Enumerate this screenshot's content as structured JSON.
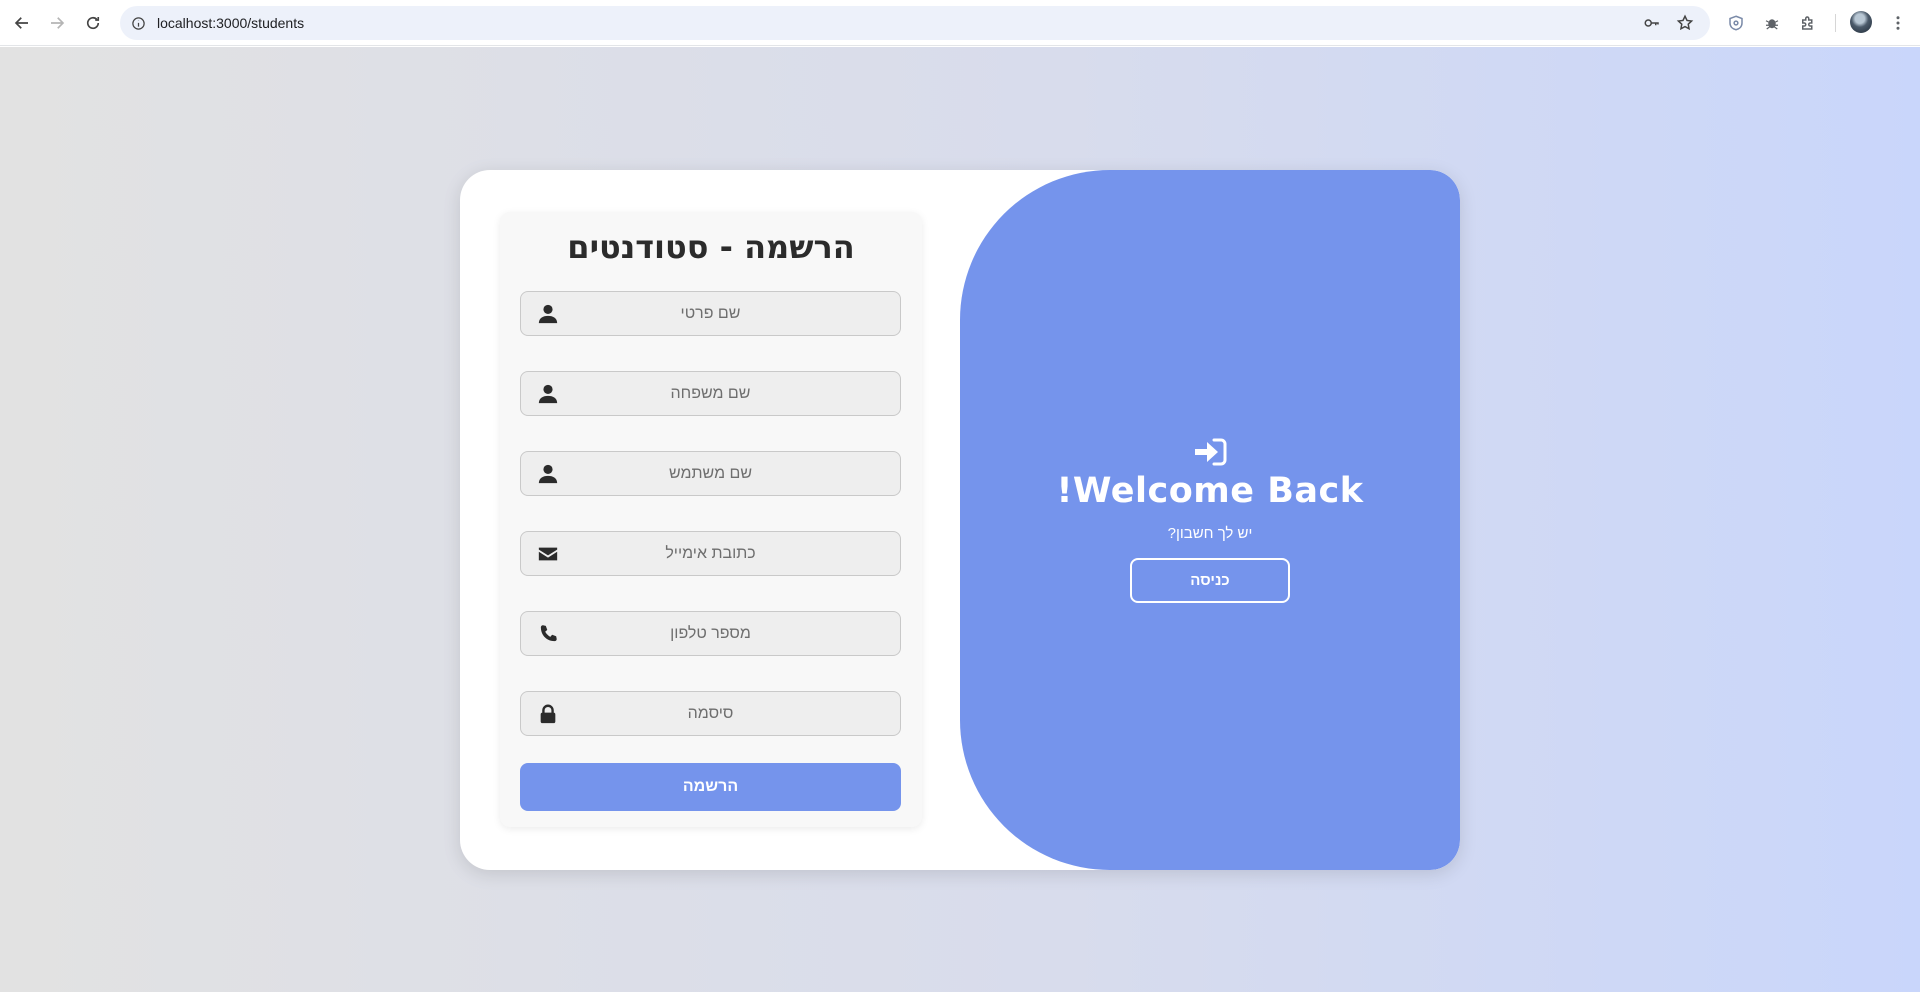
{
  "browser": {
    "url": "localhost:3000/students",
    "icons": [
      "back-arrow-icon",
      "forward-arrow-icon",
      "reload-icon",
      "site-info-icon",
      "password-key-icon",
      "bookmark-star-icon",
      "shield-extension-icon",
      "bug-extension-icon",
      "extensions-puzzle-icon",
      "profile-avatar",
      "menu-dots-icon"
    ]
  },
  "colors": {
    "accent": "#7594ec",
    "page_gradient_left": "#e2e2e2",
    "page_gradient_right": "#c9d6fb",
    "text_dark": "#2b2b2b"
  },
  "register": {
    "title": "הרשמה - סטודנטים",
    "fields": [
      {
        "placeholder": "שם פרטי",
        "icon": "user-icon",
        "value": ""
      },
      {
        "placeholder": "שם משפחה",
        "icon": "user-icon",
        "value": ""
      },
      {
        "placeholder": "שם משתמש",
        "icon": "user-icon",
        "value": ""
      },
      {
        "placeholder": "כתובת אימייל",
        "icon": "envelope-icon",
        "value": ""
      },
      {
        "placeholder": "מספר טלפון",
        "icon": "phone-icon",
        "value": ""
      },
      {
        "placeholder": "סיסמה",
        "icon": "lock-icon",
        "value": ""
      }
    ],
    "submit_label": "הרשמה"
  },
  "welcome": {
    "icon": "sign-in-icon",
    "title": "Welcome Back!",
    "text": "יש לך חשבון?",
    "button_label": "כניסה"
  }
}
